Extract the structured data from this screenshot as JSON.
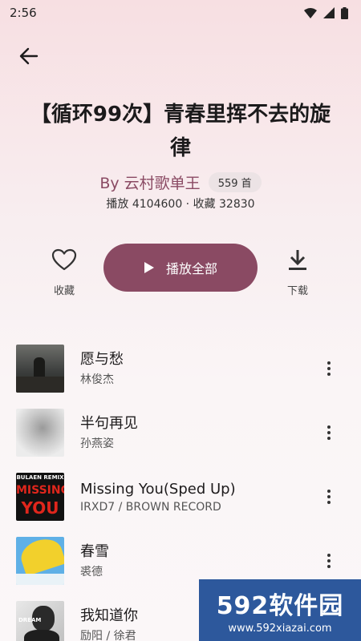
{
  "status_bar": {
    "time": "2:56"
  },
  "playlist": {
    "title": "【循环99次】青春里挥不去的旋律",
    "author": "By 云村歌单王",
    "song_count": "559 首",
    "stats": "播放 4104600 · 收藏 32830"
  },
  "actions": {
    "favorite_label": "收藏",
    "play_all_label": "播放全部",
    "download_label": "下载"
  },
  "songs": [
    {
      "title": "愿与愁",
      "artist": "林俊杰"
    },
    {
      "title": "半句再见",
      "artist": "孙燕姿"
    },
    {
      "title": "Missing You(Sped Up)",
      "artist": "IRXD7 / BROWN RECORD"
    },
    {
      "title": "春雪",
      "artist": "裘德"
    },
    {
      "title": "我知道你",
      "artist": "励阳 / 徐君"
    }
  ],
  "cover_texts": {
    "song3_top": "BULAEN REMIX",
    "song3_big1": "MISSING",
    "song3_big2": "YOU",
    "song5": "DREAM"
  },
  "watermark": {
    "brand": "592软件园",
    "url": "www.592xiazai.com"
  },
  "colors": {
    "accent": "#8a4a63",
    "watermark": "#083c8c"
  }
}
